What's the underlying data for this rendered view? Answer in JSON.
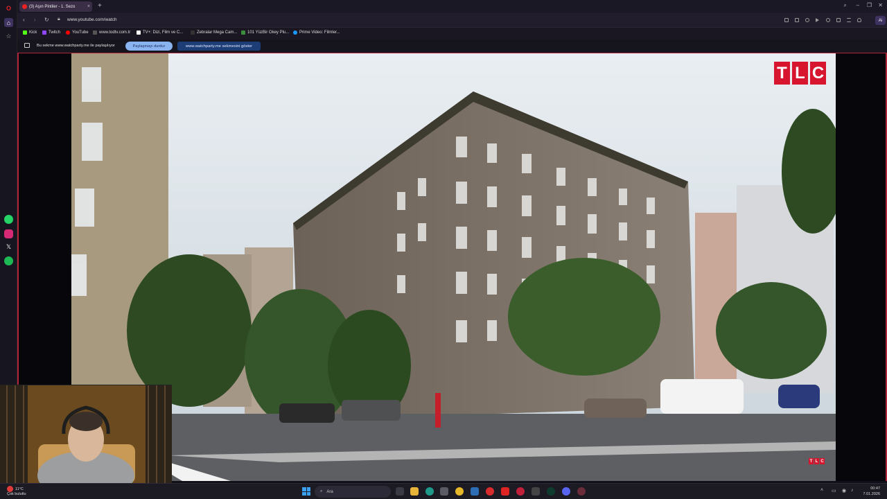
{
  "browser": {
    "tab": {
      "title": "(3) Aşın Pintiler - 1. Sezo",
      "close": "×"
    },
    "new_tab": "+",
    "url": "www.youtube.com/watch",
    "ai_label": "Ai",
    "window_controls": {
      "search": "⌕",
      "minimize": "–",
      "maximize": "❐",
      "close": "✕"
    }
  },
  "bookmarks": [
    {
      "label": "Kick",
      "color": "#53fc18"
    },
    {
      "label": "Twitch",
      "color": "#9146ff"
    },
    {
      "label": "YouTube",
      "color": "#ff0000"
    },
    {
      "label": "www.todtv.com.tr",
      "color": "#222222"
    },
    {
      "label": "TV+: Dizi, Film ve C...",
      "color": "#ffffff"
    },
    {
      "label": "Zebralar Mega Cam...",
      "color": "#333333"
    },
    {
      "label": "101 YüzBir Okey Plu...",
      "color": "#3c8c3c"
    },
    {
      "label": "Prime Video: Filmler...",
      "color": "#1a98ff"
    }
  ],
  "sharebar": {
    "message": "Bu sekme www.watchparty.me ile paylaşılıyor",
    "stop_label": "Paylaşmayı durdur",
    "show_label": "www.watchparty.me sekmesini göster"
  },
  "video": {
    "channel_logo": [
      "T",
      "L",
      "C"
    ]
  },
  "taskbar": {
    "weather_temp": "11°C",
    "weather_desc": "Çok bulutlu",
    "search_placeholder": "Ara",
    "time": "00:47",
    "date": "7.01.2026"
  },
  "colors": {
    "accent": "#b0243c",
    "tlc_red": "#d8152e",
    "share_stop": "#8ab4f0",
    "share_show": "#1d3d77"
  }
}
